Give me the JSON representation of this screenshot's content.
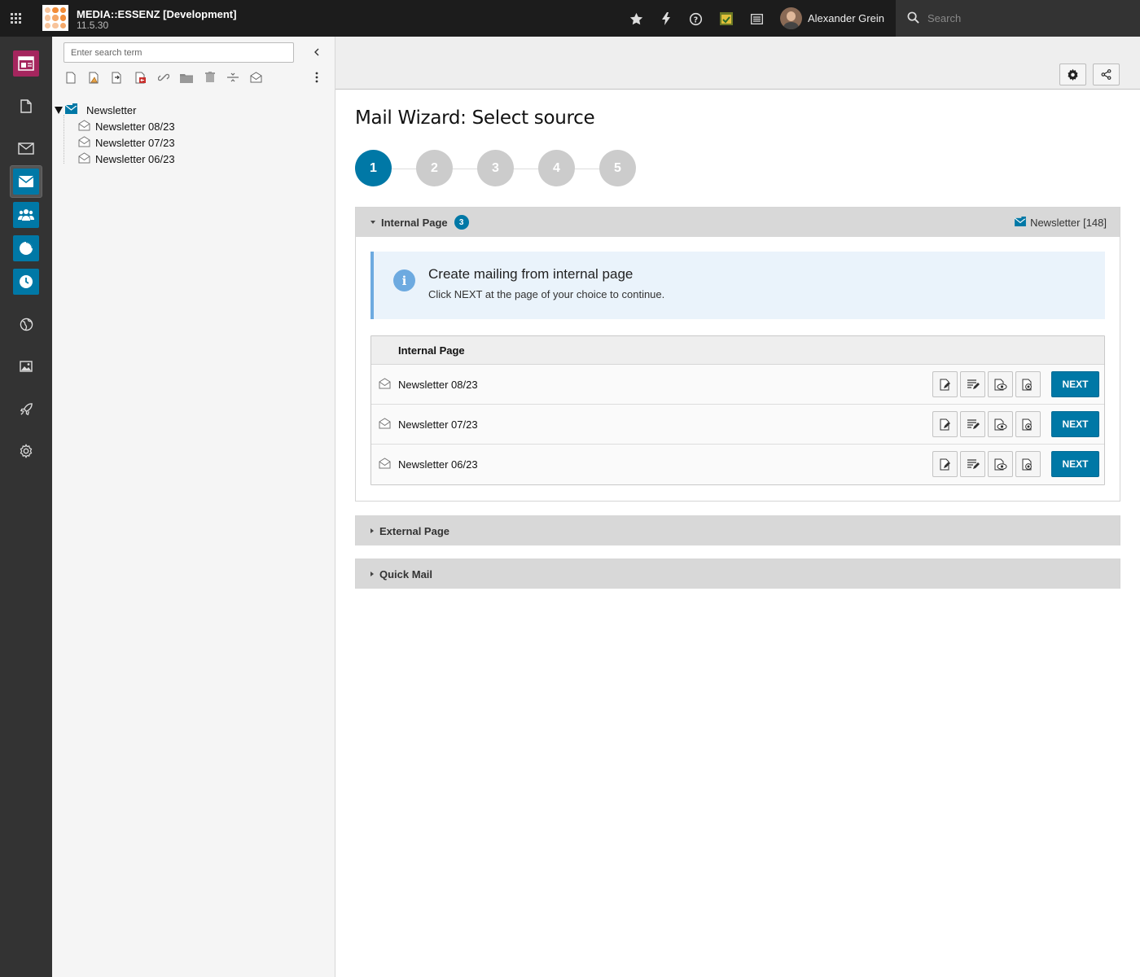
{
  "topbar": {
    "site_name": "MEDIA::ESSENZ [Development]",
    "version": "11.5.30",
    "user_name": "Alexander Grein",
    "search_placeholder": "Search"
  },
  "modules": [
    "web-page",
    "page",
    "mail",
    "direct-mail",
    "recipients",
    "statistics",
    "scheduler",
    "sites",
    "filelist",
    "deploy",
    "settings"
  ],
  "tree": {
    "search_placeholder": "Enter search term",
    "root": "Newsletter",
    "children": [
      "Newsletter 08/23",
      "Newsletter 07/23",
      "Newsletter 06/23"
    ]
  },
  "content": {
    "title": "Mail Wizard: Select source",
    "steps": [
      "1",
      "2",
      "3",
      "4",
      "5"
    ],
    "active_step": 1,
    "internal": {
      "heading": "Internal Page",
      "count": "3",
      "record_label": "Newsletter [148]",
      "callout_title": "Create mailing from internal page",
      "callout_text": "Click NEXT at the page of your choice to continue.",
      "table_header": "Internal Page",
      "rows": [
        {
          "label": "Newsletter 08/23",
          "button": "NEXT"
        },
        {
          "label": "Newsletter 07/23",
          "button": "NEXT"
        },
        {
          "label": "Newsletter 06/23",
          "button": "NEXT"
        }
      ]
    },
    "external": {
      "heading": "External Page"
    },
    "quickmail": {
      "heading": "Quick Mail"
    }
  },
  "colors": {
    "accent": "#0078a6",
    "module_magenta": "#a5265e",
    "callout_border": "#6daae0"
  }
}
